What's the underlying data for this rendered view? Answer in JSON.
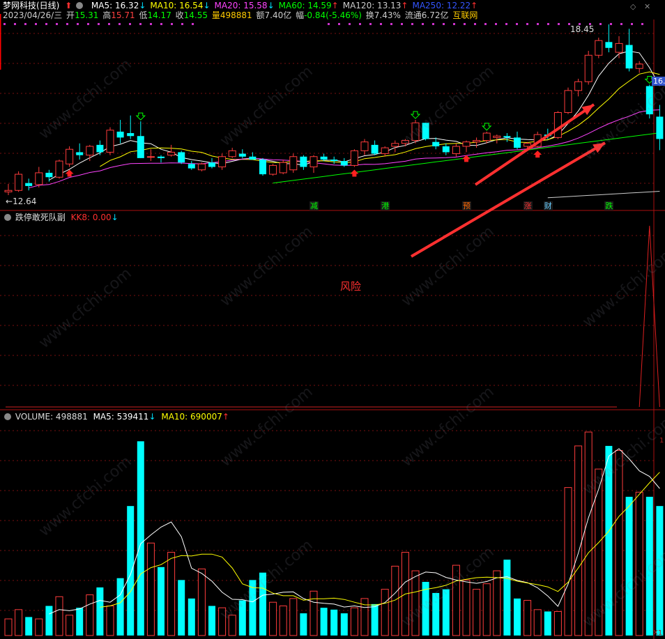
{
  "header": {
    "title": "梦网科技(日线)",
    "ma": [
      {
        "label": "MA5: 16.32",
        "color": "#ffffff",
        "arrow": "↓",
        "arrow_color": "#00e0ff"
      },
      {
        "label": "MA10: 16.54",
        "color": "#ffff00",
        "arrow": "↓",
        "arrow_color": "#00e0ff"
      },
      {
        "label": "MA20: 15.58",
        "color": "#ff44ff",
        "arrow": "↓",
        "arrow_color": "#00e0ff"
      },
      {
        "label": "MA60: 14.59",
        "color": "#00ff00",
        "arrow": "↑",
        "arrow_color": "#ff3030"
      },
      {
        "label": "MA120: 13.13",
        "color": "#cccccc",
        "arrow": "↑",
        "arrow_color": "#ff3030"
      },
      {
        "label": "MA250: 12.22",
        "color": "#3355ff",
        "arrow": "↑",
        "arrow_color": "#ff3030"
      }
    ],
    "info": {
      "date": "2023/04/26/三",
      "open_label": "开",
      "open": "15.31",
      "high_label": "高",
      "high": "15.71",
      "low_label": "低",
      "low": "14.17",
      "close_label": "收",
      "close": "14.55",
      "vol_label": "量",
      "vol": "498881",
      "amount": "额7.40亿",
      "change_label": "幅",
      "change": "-0.84(-5.46%)",
      "turnover": "换7.43%",
      "float": "流通6.72亿",
      "concept": "互联网"
    }
  },
  "price_panel": {
    "max_label": "18.45",
    "min_label": "12.64",
    "right_tag": "16."
  },
  "event_tags": [
    {
      "text": "减",
      "color": "#00ff00"
    },
    {
      "text": "港",
      "color": "#00ff00"
    },
    {
      "text": "预",
      "color": "#ff6600"
    },
    {
      "text": "涨",
      "color": "#ff3030"
    },
    {
      "text": "财",
      "color": "#66ccff"
    },
    {
      "text": "跌",
      "color": "#00ff00"
    }
  ],
  "indicator_panel": {
    "title": "跌停敢死队副",
    "value_label": "KK8: 0.00",
    "annotation": "风险"
  },
  "volume_panel": {
    "label": "VOLUME: 498881",
    "ma5": "MA5: 539411",
    "ma10": "MA10: 690007",
    "axis_tag": "1",
    "corner_tag": "X1"
  },
  "watermark_text": "www.cfchi.com",
  "colors": {
    "up": "#ff3c3c",
    "down": "#00ffff",
    "ma5": "#ffffff",
    "ma10": "#ffff00",
    "ma20": "#ff44ff",
    "ma60": "#00ff00",
    "ma120": "#cccccc",
    "grid": "#7a1010",
    "arrow": "#ff3030"
  },
  "chart_data": {
    "type": "candlestick",
    "candles": [
      {
        "o": 12.75,
        "h": 13.02,
        "l": 12.64,
        "c": 12.8
      },
      {
        "o": 12.8,
        "h": 13.45,
        "l": 12.75,
        "c": 13.35
      },
      {
        "o": 13.05,
        "h": 13.2,
        "l": 12.8,
        "c": 12.95
      },
      {
        "o": 13.0,
        "h": 13.6,
        "l": 12.9,
        "c": 13.4
      },
      {
        "o": 13.4,
        "h": 13.5,
        "l": 13.1,
        "c": 13.25
      },
      {
        "o": 13.25,
        "h": 13.85,
        "l": 13.2,
        "c": 13.8
      },
      {
        "o": 13.7,
        "h": 14.3,
        "l": 13.6,
        "c": 14.2
      },
      {
        "o": 14.1,
        "h": 14.4,
        "l": 13.85,
        "c": 14.0
      },
      {
        "o": 14.0,
        "h": 14.35,
        "l": 13.8,
        "c": 14.3
      },
      {
        "o": 14.35,
        "h": 14.5,
        "l": 14.0,
        "c": 14.1
      },
      {
        "o": 14.1,
        "h": 14.95,
        "l": 14.0,
        "c": 14.85
      },
      {
        "o": 14.8,
        "h": 15.2,
        "l": 14.4,
        "c": 14.6
      },
      {
        "o": 14.75,
        "h": 15.35,
        "l": 14.55,
        "c": 14.65
      },
      {
        "o": 14.65,
        "h": 15.15,
        "l": 13.9,
        "c": 13.9
      },
      {
        "o": 13.95,
        "h": 14.2,
        "l": 13.8,
        "c": 13.95
      },
      {
        "o": 13.95,
        "h": 14.0,
        "l": 13.75,
        "c": 13.9
      },
      {
        "o": 14.0,
        "h": 14.35,
        "l": 13.95,
        "c": 14.1
      },
      {
        "o": 14.1,
        "h": 14.15,
        "l": 13.7,
        "c": 13.75
      },
      {
        "o": 13.7,
        "h": 13.8,
        "l": 13.5,
        "c": 13.55
      },
      {
        "o": 13.5,
        "h": 13.75,
        "l": 13.45,
        "c": 13.7
      },
      {
        "o": 13.75,
        "h": 13.9,
        "l": 13.55,
        "c": 13.6
      },
      {
        "o": 13.6,
        "h": 14.05,
        "l": 13.5,
        "c": 13.95
      },
      {
        "o": 13.95,
        "h": 14.25,
        "l": 13.9,
        "c": 14.15
      },
      {
        "o": 14.05,
        "h": 14.2,
        "l": 13.9,
        "c": 13.95
      },
      {
        "o": 13.95,
        "h": 14.1,
        "l": 13.85,
        "c": 13.85
      },
      {
        "o": 13.85,
        "h": 13.9,
        "l": 13.3,
        "c": 13.35
      },
      {
        "o": 13.35,
        "h": 13.7,
        "l": 13.3,
        "c": 13.65
      },
      {
        "o": 13.4,
        "h": 13.85,
        "l": 13.35,
        "c": 13.75
      },
      {
        "o": 13.5,
        "h": 14.05,
        "l": 13.4,
        "c": 13.95
      },
      {
        "o": 13.95,
        "h": 14.0,
        "l": 13.5,
        "c": 13.6
      },
      {
        "o": 13.6,
        "h": 14.0,
        "l": 13.4,
        "c": 13.95
      },
      {
        "o": 13.95,
        "h": 14.05,
        "l": 13.8,
        "c": 13.85
      },
      {
        "o": 13.85,
        "h": 13.95,
        "l": 13.7,
        "c": 13.8
      },
      {
        "o": 13.8,
        "h": 13.9,
        "l": 13.6,
        "c": 13.65
      },
      {
        "o": 13.65,
        "h": 14.2,
        "l": 13.6,
        "c": 14.15
      },
      {
        "o": 14.15,
        "h": 14.55,
        "l": 14.0,
        "c": 14.45
      },
      {
        "o": 14.35,
        "h": 14.5,
        "l": 14.0,
        "c": 14.05
      },
      {
        "o": 14.05,
        "h": 14.3,
        "l": 13.95,
        "c": 14.25
      },
      {
        "o": 14.3,
        "h": 14.5,
        "l": 14.1,
        "c": 14.4
      },
      {
        "o": 14.4,
        "h": 14.55,
        "l": 14.3,
        "c": 14.5
      },
      {
        "o": 14.5,
        "h": 15.2,
        "l": 14.4,
        "c": 15.1
      },
      {
        "o": 15.1,
        "h": 15.1,
        "l": 14.5,
        "c": 14.55
      },
      {
        "o": 14.45,
        "h": 14.6,
        "l": 14.2,
        "c": 14.3
      },
      {
        "o": 14.3,
        "h": 14.4,
        "l": 14.0,
        "c": 14.1
      },
      {
        "o": 14.05,
        "h": 14.4,
        "l": 13.95,
        "c": 14.3
      },
      {
        "o": 14.3,
        "h": 14.5,
        "l": 14.1,
        "c": 14.45
      },
      {
        "o": 14.45,
        "h": 14.6,
        "l": 14.25,
        "c": 14.5
      },
      {
        "o": 14.5,
        "h": 14.8,
        "l": 14.4,
        "c": 14.75
      },
      {
        "o": 14.6,
        "h": 14.7,
        "l": 14.4,
        "c": 14.65
      },
      {
        "o": 14.65,
        "h": 14.75,
        "l": 14.45,
        "c": 14.6
      },
      {
        "o": 14.6,
        "h": 14.8,
        "l": 14.2,
        "c": 14.25
      },
      {
        "o": 14.3,
        "h": 14.45,
        "l": 14.2,
        "c": 14.4
      },
      {
        "o": 14.3,
        "h": 14.8,
        "l": 14.25,
        "c": 14.7
      },
      {
        "o": 14.7,
        "h": 14.9,
        "l": 14.55,
        "c": 14.65
      },
      {
        "o": 14.6,
        "h": 15.5,
        "l": 14.55,
        "c": 15.45
      },
      {
        "o": 15.45,
        "h": 16.3,
        "l": 15.4,
        "c": 16.2
      },
      {
        "o": 16.2,
        "h": 16.6,
        "l": 16.0,
        "c": 16.5
      },
      {
        "o": 16.5,
        "h": 17.55,
        "l": 16.4,
        "c": 17.4
      },
      {
        "o": 17.4,
        "h": 18.0,
        "l": 17.3,
        "c": 17.9
      },
      {
        "o": 17.85,
        "h": 18.45,
        "l": 17.5,
        "c": 17.65
      },
      {
        "o": 17.5,
        "h": 18.05,
        "l": 17.3,
        "c": 17.8
      },
      {
        "o": 17.75,
        "h": 18.3,
        "l": 16.85,
        "c": 16.95
      },
      {
        "o": 16.95,
        "h": 17.2,
        "l": 16.8,
        "c": 17.1
      },
      {
        "o": 16.35,
        "h": 16.4,
        "l": 15.25,
        "c": 15.39
      },
      {
        "o": 15.31,
        "h": 15.71,
        "l": 14.17,
        "c": 14.55
      }
    ],
    "volume": [
      18,
      28,
      20,
      18,
      32,
      42,
      22,
      30,
      44,
      52,
      32,
      62,
      140,
      210,
      100,
      74,
      90,
      60,
      40,
      72,
      32,
      30,
      22,
      38,
      60,
      68,
      36,
      32,
      40,
      24,
      48,
      30,
      28,
      24,
      30,
      40,
      34,
      50,
      75,
      90,
      70,
      58,
      46,
      50,
      76,
      60,
      50,
      56,
      70,
      82,
      40,
      38,
      28,
      26,
      26,
      160,
      205,
      220,
      180,
      205,
      200,
      150,
      155,
      150,
      140
    ],
    "kk8_spike": {
      "index": 63,
      "value": 1.0
    }
  }
}
